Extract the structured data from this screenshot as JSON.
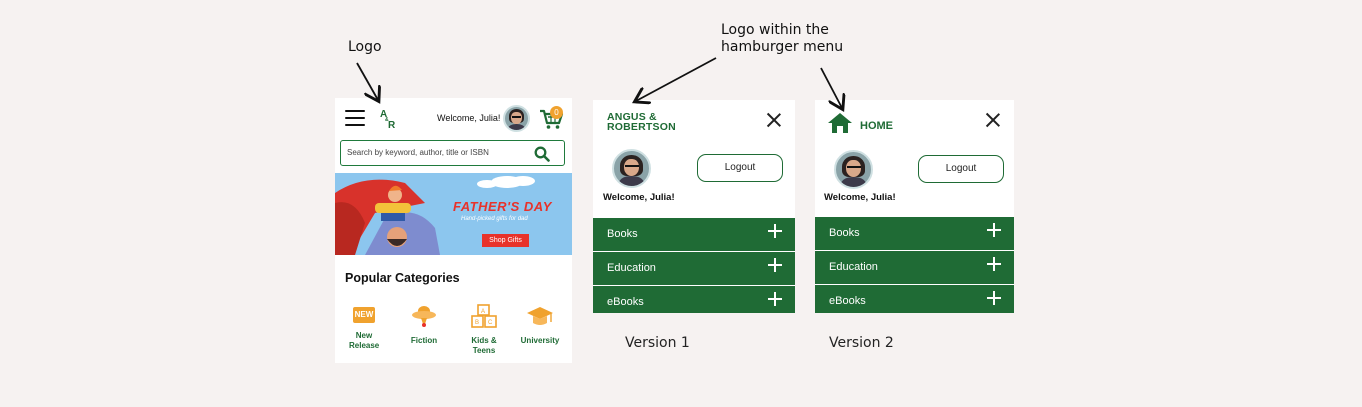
{
  "annotations": {
    "logo_label": "Logo",
    "menu_logo_label_line1": "Logo within the",
    "menu_logo_label_line2": "hamburger menu"
  },
  "homepage": {
    "logo_text": "A&R",
    "welcome": "Welcome, Julia!",
    "cart_count": "0",
    "search_placeholder": "Search by keyword, author, title or ISBN",
    "banner": {
      "title": "FATHER'S DAY",
      "subtitle": "Hand-picked gifts for dad",
      "button": "Shop Gifts"
    },
    "popular_title": "Popular Categories",
    "categories": [
      {
        "label": "New Release",
        "badge": "NEW",
        "icon": "new-badge-icon"
      },
      {
        "label": "Fiction",
        "icon": "ufo-icon"
      },
      {
        "label": "Kids & Teens",
        "icon": "blocks-icon"
      },
      {
        "label": "University",
        "icon": "graduation-cap-icon"
      }
    ]
  },
  "menu_v1": {
    "logo_line1": "ANGUS &",
    "logo_line2": "ROBERTSON",
    "logout": "Logout",
    "welcome": "Welcome, Julia!",
    "items": [
      "Books",
      "Education",
      "eBooks"
    ],
    "version_label": "Version 1"
  },
  "menu_v2": {
    "home_label": "HOME",
    "logout": "Logout",
    "welcome": "Welcome, Julia!",
    "items": [
      "Books",
      "Education",
      "eBooks"
    ],
    "version_label": "Version 2"
  },
  "colors": {
    "brand_green": "#1f6b35",
    "accent_orange": "#f0a22e",
    "banner_red": "#e8322a",
    "background": "#f6f2f1"
  }
}
